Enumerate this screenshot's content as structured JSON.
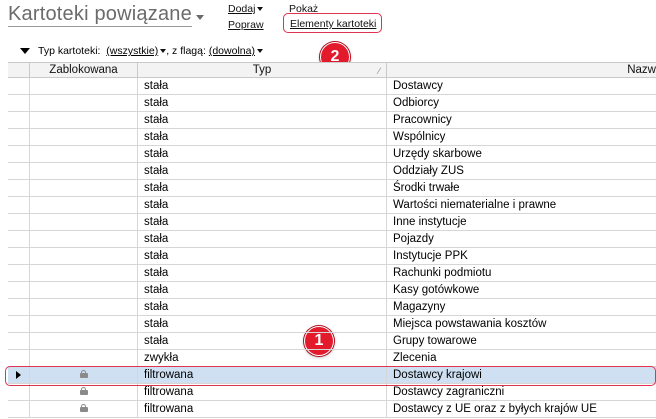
{
  "header": {
    "title": "Kartoteki powiązane",
    "menu": {
      "dodaj": "Dodaj",
      "popraw": "Popraw",
      "pokaz": "Pokaż",
      "elementy": "Elementy kartoteki"
    }
  },
  "badges": {
    "one": "1",
    "two": "2"
  },
  "filter": {
    "typ_label": "Typ kartoteki:",
    "typ_value": "(wszystkie)",
    "flag_label": ", z flagą:",
    "flag_value": "(dowolna)"
  },
  "grid": {
    "columns": {
      "zablokowana": "Zablokowana",
      "typ": "Typ",
      "nazwa": "Nazw"
    },
    "rows": [
      {
        "typ": "stała",
        "nazwa": "Dostawcy",
        "locked": false
      },
      {
        "typ": "stała",
        "nazwa": "Odbiorcy",
        "locked": false
      },
      {
        "typ": "stała",
        "nazwa": "Pracownicy",
        "locked": false
      },
      {
        "typ": "stała",
        "nazwa": "Wspólnicy",
        "locked": false
      },
      {
        "typ": "stała",
        "nazwa": "Urzędy skarbowe",
        "locked": false
      },
      {
        "typ": "stała",
        "nazwa": "Oddziały ZUS",
        "locked": false
      },
      {
        "typ": "stała",
        "nazwa": "Środki trwałe",
        "locked": false
      },
      {
        "typ": "stała",
        "nazwa": "Wartości niematerialne i prawne",
        "locked": false
      },
      {
        "typ": "stała",
        "nazwa": "Inne instytucje",
        "locked": false
      },
      {
        "typ": "stała",
        "nazwa": "Pojazdy",
        "locked": false
      },
      {
        "typ": "stała",
        "nazwa": "Instytucje PPK",
        "locked": false
      },
      {
        "typ": "stała",
        "nazwa": "Rachunki podmiotu",
        "locked": false
      },
      {
        "typ": "stała",
        "nazwa": "Kasy gotówkowe",
        "locked": false
      },
      {
        "typ": "stała",
        "nazwa": "Magazyny",
        "locked": false
      },
      {
        "typ": "stała",
        "nazwa": "Miejsca powstawania kosztów",
        "locked": false
      },
      {
        "typ": "stała",
        "nazwa": "Grupy towarowe",
        "locked": false
      },
      {
        "typ": "zwykła",
        "nazwa": "Zlecenia",
        "locked": false
      },
      {
        "typ": "filtrowana",
        "nazwa": "Dostawcy krajowi",
        "locked": true,
        "selected": true
      },
      {
        "typ": "filtrowana",
        "nazwa": "Dostawcy zagraniczni",
        "locked": true
      },
      {
        "typ": "filtrowana",
        "nazwa": "Dostawcy z UE oraz z byłych krajów UE",
        "locked": true
      }
    ]
  }
}
